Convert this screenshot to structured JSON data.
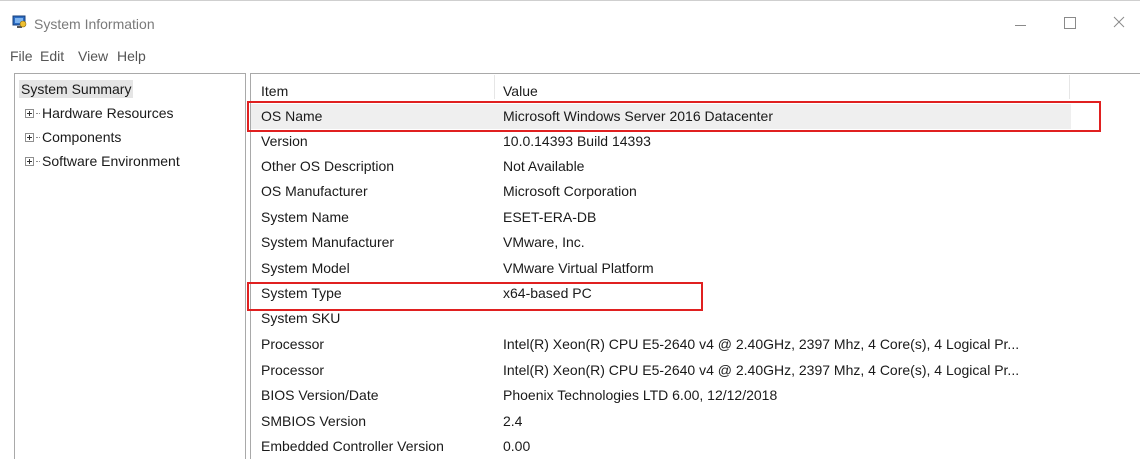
{
  "window": {
    "title": "System Information",
    "icon": "system-information-icon",
    "controls": {
      "minimize_icon": "minimize-icon",
      "maximize_icon": "maximize-icon",
      "close_icon": "close-icon"
    }
  },
  "menu": {
    "file": "File",
    "edit": "Edit",
    "view": "View",
    "help": "Help"
  },
  "tree": {
    "root": "System Summary",
    "nodes": [
      {
        "label": "Hardware Resources",
        "icon": "expand-plus-icon"
      },
      {
        "label": "Components",
        "icon": "expand-plus-icon"
      },
      {
        "label": "Software Environment",
        "icon": "expand-plus-icon"
      }
    ]
  },
  "list": {
    "columns": {
      "item": "Item",
      "value": "Value"
    },
    "rows": [
      {
        "item": "OS Name",
        "value": "Microsoft Windows Server 2016 Datacenter",
        "selected": true
      },
      {
        "item": "Version",
        "value": "10.0.14393 Build 14393"
      },
      {
        "item": "Other OS Description",
        "value": "Not Available"
      },
      {
        "item": "OS Manufacturer",
        "value": "Microsoft Corporation"
      },
      {
        "item": "System Name",
        "value": "ESET-ERA-DB"
      },
      {
        "item": "System Manufacturer",
        "value": "VMware, Inc."
      },
      {
        "item": "System Model",
        "value": "VMware Virtual Platform"
      },
      {
        "item": "System Type",
        "value": "x64-based PC"
      },
      {
        "item": "System SKU",
        "value": ""
      },
      {
        "item": "Processor",
        "value": "Intel(R) Xeon(R) CPU E5-2640 v4 @ 2.40GHz, 2397 Mhz, 4 Core(s), 4 Logical Pr..."
      },
      {
        "item": "Processor",
        "value": "Intel(R) Xeon(R) CPU E5-2640 v4 @ 2.40GHz, 2397 Mhz, 4 Core(s), 4 Logical Pr..."
      },
      {
        "item": "BIOS Version/Date",
        "value": "Phoenix Technologies LTD 6.00, 12/12/2018"
      },
      {
        "item": "SMBIOS Version",
        "value": "2.4"
      },
      {
        "item": "Embedded Controller Version",
        "value": "0.00"
      }
    ]
  },
  "colors": {
    "highlight_box": "#e02020",
    "selected_row": "#efefef"
  }
}
